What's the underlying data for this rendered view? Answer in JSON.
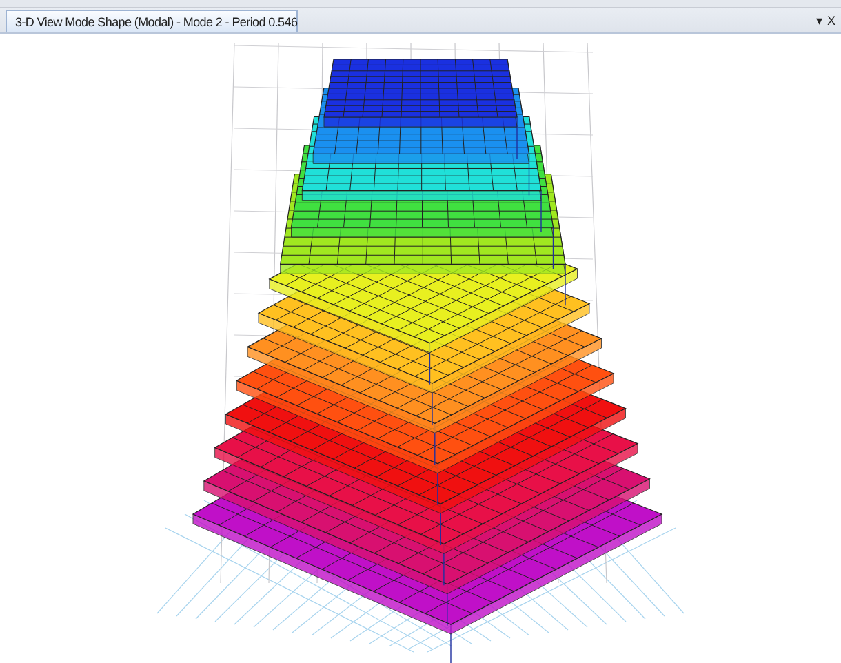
{
  "tab": {
    "label": "3-D View  Mode Shape (Modal) - Mode 2 - Period 0.546",
    "selected": true
  },
  "window_controls": [
    {
      "label": "▾"
    },
    {
      "label": "X"
    }
  ]
}
